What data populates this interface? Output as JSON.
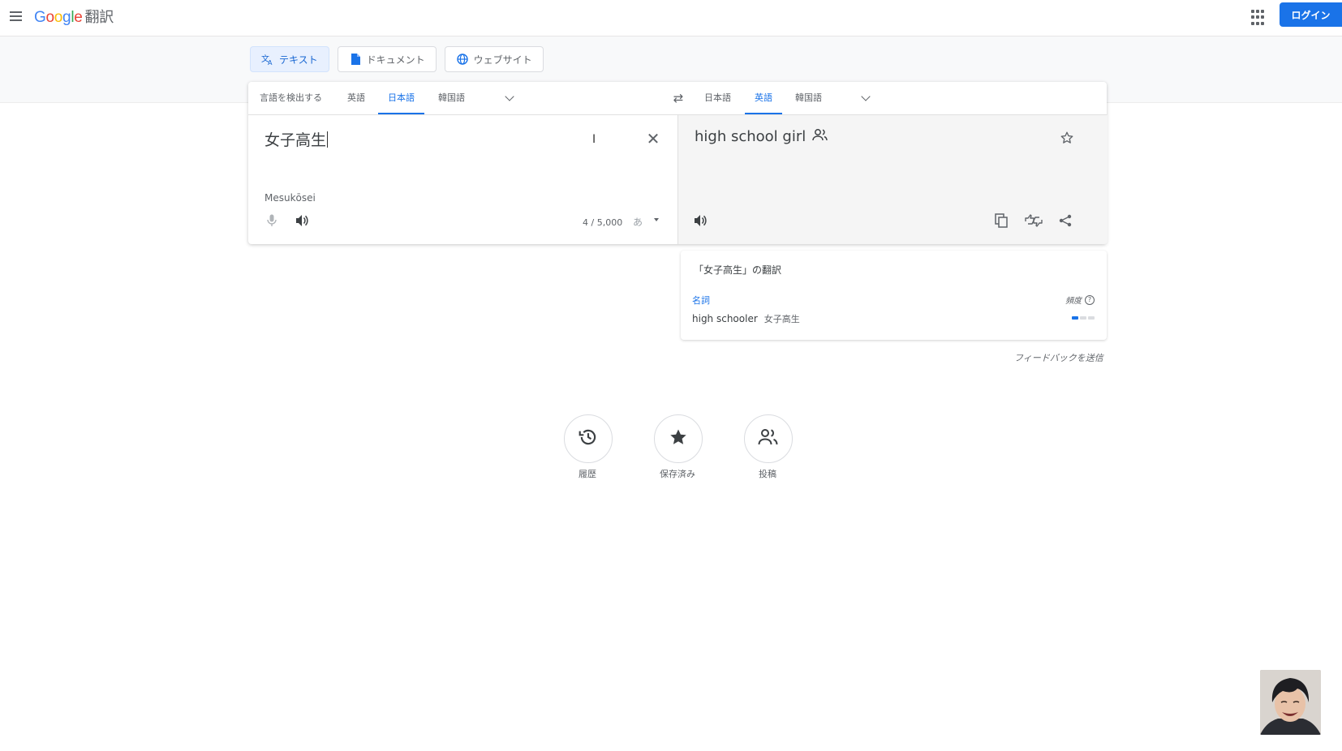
{
  "header": {
    "logo": {
      "letters": [
        "G",
        "o",
        "o",
        "g",
        "l",
        "e"
      ],
      "product": "翻訳"
    },
    "login_label": "ログイン"
  },
  "mode_tabs": [
    {
      "label": "テキスト",
      "icon": "translate-icon",
      "active": true
    },
    {
      "label": "ドキュメント",
      "icon": "document-icon",
      "active": false
    },
    {
      "label": "ウェブサイト",
      "icon": "globe-icon",
      "active": false
    }
  ],
  "source": {
    "languages": [
      "言語を検出する",
      "英語",
      "日本語",
      "韓国語"
    ],
    "selected": "日本語",
    "text": "女子高生",
    "romanization": "Mesukōsei",
    "char_count": "4 / 5,000",
    "ime_label": "あ"
  },
  "target": {
    "languages": [
      "日本語",
      "英語",
      "韓国語"
    ],
    "selected": "英語",
    "text": "high school girl"
  },
  "dictionary": {
    "title": "「女子高生」の翻訳",
    "pos": "名詞",
    "frequency_label": "頻度",
    "help_glyph": "?",
    "entry_word": "high schooler",
    "entry_synonym": "女子高生",
    "frequency": 1
  },
  "feedback_label": "フィードバックを送信",
  "bottom_buttons": [
    {
      "label": "履歴",
      "icon": "history-icon"
    },
    {
      "label": "保存済み",
      "icon": "star-filled-icon"
    },
    {
      "label": "投稿",
      "icon": "people-icon"
    }
  ],
  "colors": {
    "accent": "#1a73e8",
    "tab_active_bg": "#e8f0fe",
    "target_bg": "#f5f5f5"
  }
}
